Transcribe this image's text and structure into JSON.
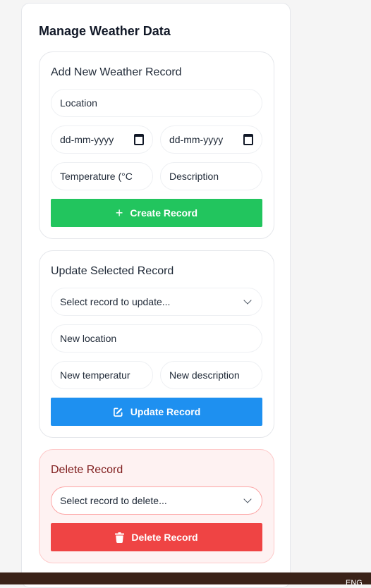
{
  "panel": {
    "title": "Manage Weather Data"
  },
  "create": {
    "title": "Add New Weather Record",
    "location_placeholder": "Location",
    "start_date_placeholder": "dd-mm-yyyy",
    "end_date_placeholder": "dd-mm-yyyy",
    "temperature_placeholder": "Temperature (°C",
    "description_placeholder": "Description",
    "button_label": "Create Record",
    "button_icon": "plus-icon",
    "button_color": "#22c55e"
  },
  "update": {
    "title": "Update Selected Record",
    "select_label": "Select record to update...",
    "location_placeholder": "New location",
    "temperature_placeholder": "New temperatur",
    "description_placeholder": "New description",
    "button_label": "Update Record",
    "button_icon": "edit-icon",
    "button_color": "#1e90f0"
  },
  "delete": {
    "title": "Delete Record",
    "select_label": "Select record to delete...",
    "button_label": "Delete Record",
    "button_icon": "trash-icon",
    "button_color": "#ef4444"
  },
  "footer": {
    "language_code": "ENG"
  }
}
